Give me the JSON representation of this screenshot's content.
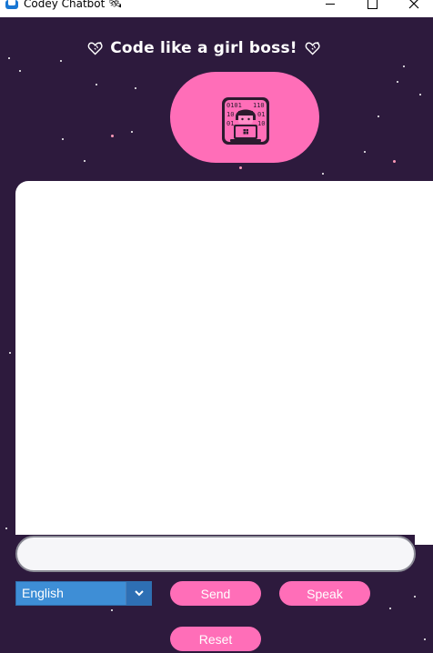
{
  "window": {
    "title": "Codey Chatbot 🛰",
    "minimize_icon": "minimize-icon",
    "maximize_icon": "maximize-icon",
    "close_icon": "close-icon"
  },
  "header": {
    "text": "Code like a girl boss!",
    "left_icon": "sparkle-heart-icon",
    "right_icon": "sparkle-heart-icon"
  },
  "avatar": {
    "icon": "coder-girl-laptop-icon"
  },
  "chat": {
    "messages": []
  },
  "input": {
    "value": "",
    "placeholder": ""
  },
  "language": {
    "selected": "English",
    "icon": "chevron-down-icon"
  },
  "buttons": {
    "send": "Send",
    "speak": "Speak",
    "reset": "Reset"
  },
  "colors": {
    "background": "#2d1a3d",
    "accent_pink": "#ff6eb8",
    "select_blue": "#3e8ed6",
    "chat_background": "#ffffff"
  }
}
